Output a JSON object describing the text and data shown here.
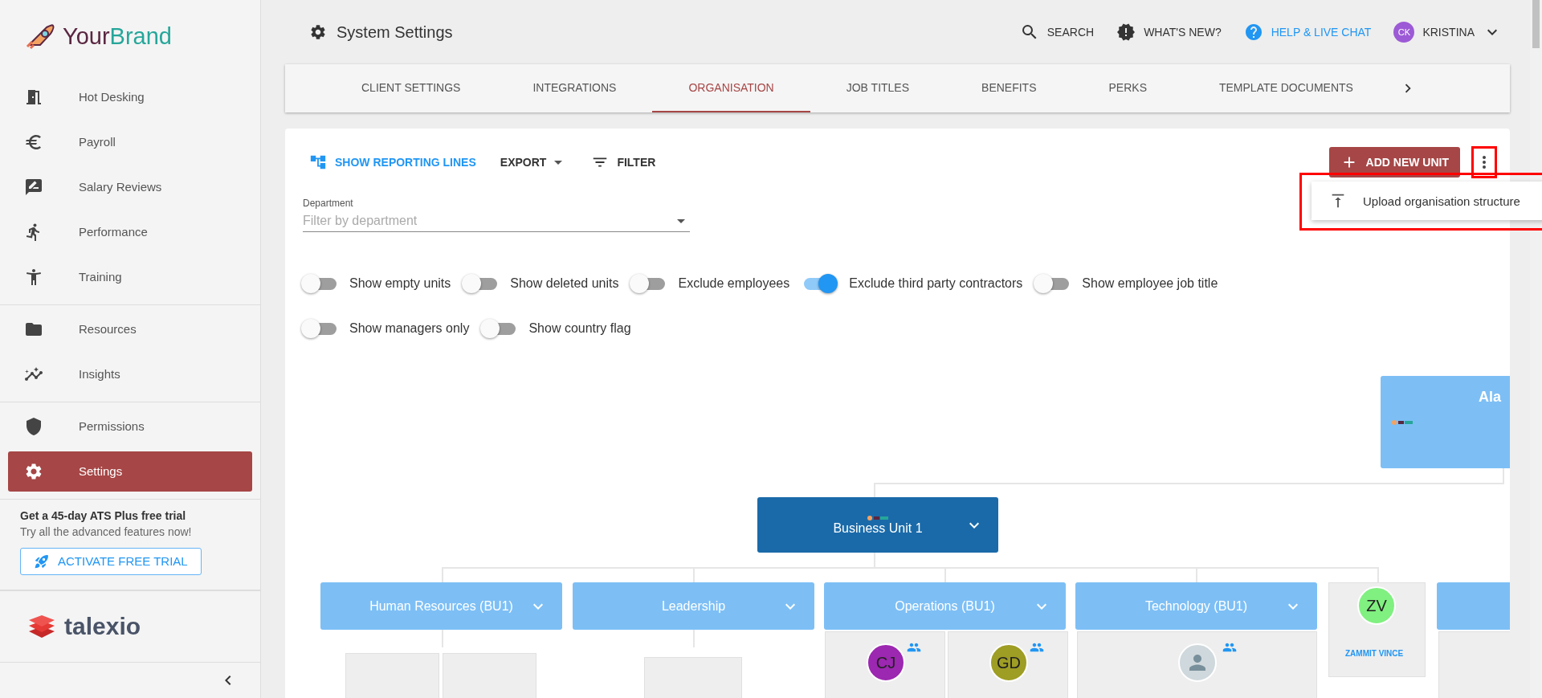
{
  "brand": {
    "name_part_1": "Your",
    "name_part_2": "Brand"
  },
  "sidebar": {
    "sections": [
      {
        "items": [
          {
            "label": "Hot Desking",
            "selected": false
          },
          {
            "label": "Payroll",
            "selected": false
          },
          {
            "label": "Salary Reviews",
            "selected": false
          },
          {
            "label": "Performance",
            "selected": false
          },
          {
            "label": "Training",
            "selected": false
          }
        ]
      },
      {
        "items": [
          {
            "label": "Resources",
            "selected": false
          },
          {
            "label": "Insights",
            "selected": false
          }
        ]
      },
      {
        "items": [
          {
            "label": "Permissions",
            "selected": false
          },
          {
            "label": "Settings",
            "selected": true
          }
        ]
      }
    ],
    "promo": {
      "title": "Get a 45-day ATS Plus free trial",
      "text": "Try all the advanced features now!",
      "button": "ACTIVATE FREE TRIAL"
    },
    "vendor": "talexio"
  },
  "header": {
    "title": "System Settings",
    "actions": [
      {
        "label": "SEARCH",
        "kind": "search"
      },
      {
        "label": "WHAT'S NEW?",
        "kind": "news"
      },
      {
        "label": "HELP & LIVE CHAT",
        "kind": "help"
      }
    ],
    "user": {
      "initials": "CK",
      "name": "KRISTINA"
    }
  },
  "tabs": [
    {
      "label": "CLIENT SETTINGS",
      "selected": false
    },
    {
      "label": "INTEGRATIONS",
      "selected": false
    },
    {
      "label": "ORGANISATION",
      "selected": true
    },
    {
      "label": "JOB TITLES",
      "selected": false
    },
    {
      "label": "BENEFITS",
      "selected": false
    },
    {
      "label": "PERKS",
      "selected": false
    },
    {
      "label": "TEMPLATE DOCUMENTS",
      "selected": false
    }
  ],
  "toolbar": {
    "reporting_lines": "SHOW REPORTING LINES",
    "export": "EXPORT",
    "filter": "FILTER",
    "add_button": "ADD NEW UNIT"
  },
  "menu": {
    "items": [
      "Upload organisation structure"
    ]
  },
  "department": {
    "label": "Department",
    "placeholder": "Filter by department"
  },
  "toggles": [
    {
      "label": "Show empty units",
      "on": false
    },
    {
      "label": "Show deleted units",
      "on": false
    },
    {
      "label": "Exclude employees",
      "on": false
    },
    {
      "label": "Exclude third party contractors",
      "on": true
    },
    {
      "label": "Show employee job title",
      "on": false
    },
    {
      "label": "Show managers only",
      "on": false
    },
    {
      "label": "Show country flag",
      "on": false
    }
  ],
  "org_chart": {
    "root": {
      "title": "Ala"
    },
    "unit": {
      "title": "Business Unit 1"
    },
    "departments": [
      {
        "title": "Human Resources (BU1)"
      },
      {
        "title": "Leadership"
      },
      {
        "title": "Operations (BU1)"
      },
      {
        "title": "Technology (BU1)"
      }
    ],
    "people": [
      {
        "initials": "CJ",
        "color": "#9c27b0"
      },
      {
        "initials": "GD",
        "color": "#9e9d24"
      }
    ],
    "person_card": {
      "initials": "ZV",
      "name": "ZAMMIT VINCE",
      "color": "#80f080"
    }
  }
}
